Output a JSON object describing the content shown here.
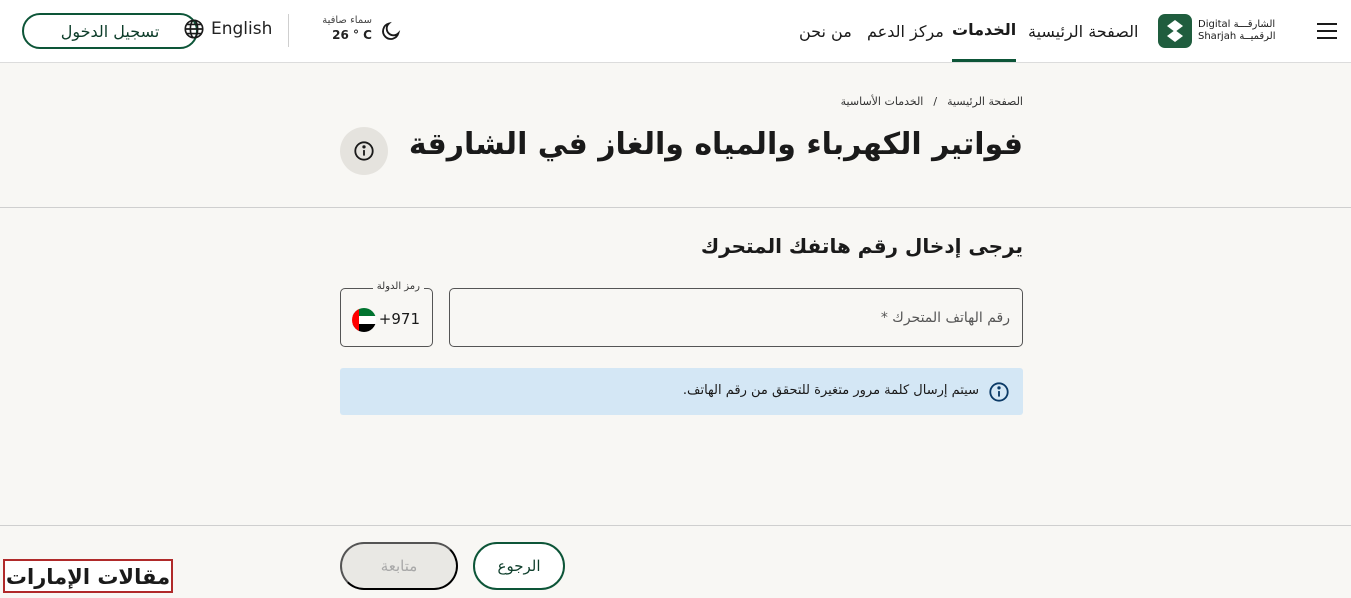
{
  "header": {
    "login_label": "تسجيل الدخول",
    "language_label": "English",
    "weather_condition": "سماء صافية",
    "weather_temp": "26 ° C",
    "nav": [
      "الصفحة الرئيسية",
      "الخدمات",
      "مركز الدعم",
      "من نحن"
    ],
    "active_nav": "الخدمات",
    "logo_ar_1": "الشارقـــة",
    "logo_ar_2": "الرقميــة",
    "logo_en_1": "Digital",
    "logo_en_2": "Sharjah"
  },
  "breadcrumb": [
    "الصفحة الرئيسية",
    "/",
    "الخدمات الأساسية"
  ],
  "page_title": "فواتير الكهرباء والمياه والغاز في الشارقة",
  "form": {
    "heading": "يرجى إدخال رقم هاتفك المتحرك",
    "phone_placeholder": "رقم الهاتف المتحرك *",
    "country_code_label": "رمز الدولة",
    "country_code_value": "+971",
    "notice": "سيتم إرسال كلمة مرور متغيرة للتحقق من رقم الهاتف."
  },
  "footer": {
    "back_label": "الرجوع",
    "next_label": "متابعة"
  },
  "watermark": "مقالات الإمارات",
  "colors": {
    "brand_green": "#0d5538",
    "notice_bg": "#d4e7f5",
    "page_bg": "#f8f7f4"
  }
}
